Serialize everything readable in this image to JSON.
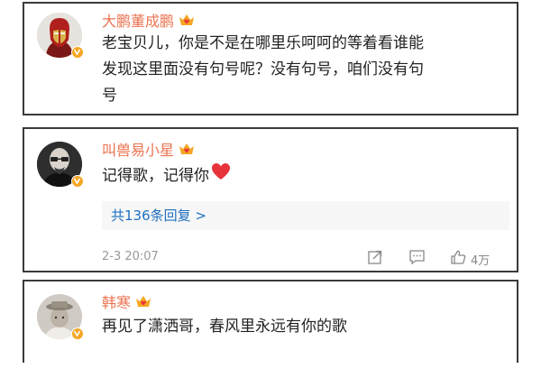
{
  "comments": [
    {
      "username": "大鹏董成鹏",
      "avatar_icon": "iron-man-avatar",
      "badge_icon": "verified-v-icon",
      "level_icon": "crown-heart-icon",
      "text_line1": "老宝贝儿，你是不是在哪里乐呵呵的等着看谁能",
      "text_line2": "发现这里面没有句号呢？没有句号，咱们没有句",
      "text_line3": "号"
    },
    {
      "username": "叫兽易小星",
      "avatar_icon": "man-with-glasses-avatar",
      "badge_icon": "verified-v-icon",
      "level_icon": "crown-heart-icon",
      "text": "记得歌，记得你",
      "emoji_icon": "red-heart-icon",
      "replies_label": "共136条回复 >",
      "timestamp": "2-3 20:07",
      "like_count": "4万"
    },
    {
      "username": "韩寒",
      "avatar_icon": "boy-in-hat-avatar",
      "badge_icon": "verified-v-icon",
      "level_icon": "crown-heart-icon",
      "text": "再见了潇洒哥，春风里永远有你的歌"
    }
  ],
  "colors": {
    "username": "#eb7350",
    "link": "#1f6fc0",
    "badge": "#f5a623",
    "heart": "#e8333a"
  }
}
